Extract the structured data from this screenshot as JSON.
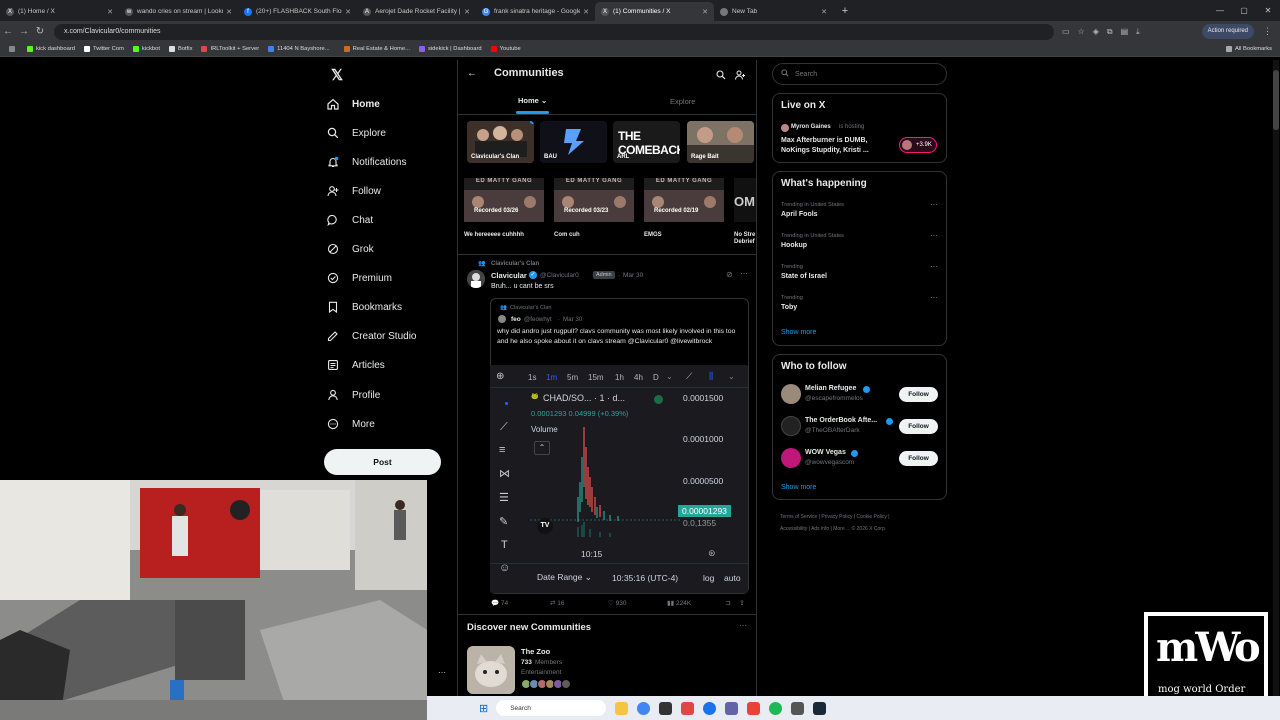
{
  "tabs": [
    {
      "title": "(1) Home / X",
      "fav": "X"
    },
    {
      "title": "wando cries on stream | Lookup",
      "fav": "w"
    },
    {
      "title": "(20+) FLASHBACK South Florida",
      "fav": "f"
    },
    {
      "title": "Aerojet Dade Rocket Facility | A",
      "fav": "A"
    },
    {
      "title": "frank sinatra heritage - Google",
      "fav": "G"
    },
    {
      "title": "(1) Communities / X",
      "fav": "X"
    },
    {
      "title": "New Tab",
      "fav": ""
    }
  ],
  "address": {
    "url": "x.com/Clavicular0/communities",
    "action_required": "Action required"
  },
  "bookmarks": [
    "kick dashboard",
    "Twitter Com",
    "kickbot",
    "Botfix",
    "IRLToolkit + Server",
    "11404 N Bayshore...",
    "Real Estate & Home...",
    "sidekick | Dashboard",
    "Youtube"
  ],
  "all_bookmarks": "All Bookmarks",
  "nav": {
    "items": [
      {
        "label": "Home",
        "icon": "home-icon"
      },
      {
        "label": "Explore",
        "icon": "search-icon"
      },
      {
        "label": "Notifications",
        "icon": "bell-icon"
      },
      {
        "label": "Follow",
        "icon": "person-plus-icon"
      },
      {
        "label": "Chat",
        "icon": "chat-icon"
      },
      {
        "label": "Grok",
        "icon": "grok-icon"
      },
      {
        "label": "Premium",
        "icon": "premium-icon"
      },
      {
        "label": "Bookmarks",
        "icon": "bookmark-icon"
      },
      {
        "label": "Creator Studio",
        "icon": "creator-icon"
      },
      {
        "label": "Articles",
        "icon": "article-icon"
      },
      {
        "label": "Profile",
        "icon": "person-icon"
      },
      {
        "label": "More",
        "icon": "more-circle-icon"
      }
    ],
    "post": "Post"
  },
  "communities": {
    "title": "Communities",
    "tab_home": "Home",
    "tab_explore": "Explore",
    "tiles": [
      "Clavicular's Clan",
      "BAU",
      "ARL",
      "Rage Bait"
    ],
    "comeback_text": "THE COMEBACK",
    "recordings": [
      {
        "band": "ED MATTY GANG",
        "badge": "Recorded 03/26",
        "title": "We hereeeee cuhhhh"
      },
      {
        "band": "ED MATTY GANG",
        "badge": "Recorded 03/23",
        "title": "Com cuh"
      },
      {
        "band": "ED MATTY GANG",
        "badge": "Recorded 02/19",
        "title": "EMGS"
      },
      {
        "band": "OM",
        "badge": "",
        "title": "No Stre Debrief"
      }
    ],
    "post": {
      "community": "Clavicular's Clan",
      "author": "Clavicular",
      "handle": "@Clavicular0",
      "role": "Admin",
      "date": "Mar 30",
      "text": "Bruh... u cant be srs",
      "quote": {
        "community": "Clavicular's Clan",
        "author": "feo",
        "handle": "@feowhyt",
        "date": "Mar 30",
        "text": "why did andro just rugpull? clavs community was most likely involved in this too and he also spoke about it on clavs stream @Clavicular0 @livewitbrock"
      },
      "chart": {
        "intervals": [
          "1s",
          "1m",
          "5m",
          "15m",
          "1h",
          "4h",
          "D"
        ],
        "active_interval": "1m",
        "symbol": "CHAD/SO...",
        "symbol_suffix": "· 1 · d...",
        "ohlc": "0.0001293 0.04999 (+0.39%)",
        "volume": "Volume",
        "prices": [
          "0.0001500",
          "0.0001000",
          "0.0000500"
        ],
        "current_price": "0.00001293",
        "last_price": "0.0,1355",
        "time_label": "10:15",
        "date_range": "Date Range",
        "clock": "10:35:16 (UTC-4)",
        "log": "log",
        "auto": "auto"
      },
      "stats": {
        "replies": "74",
        "reposts": "16",
        "likes": "930",
        "views": "224K"
      }
    },
    "discover": {
      "title": "Discover new Communities",
      "name": "The Zoo",
      "members": "733",
      "members_label": "Members",
      "category": "Entertainment"
    }
  },
  "right": {
    "search_placeholder": "Search",
    "live": {
      "title": "Live on X",
      "host": "Myron Gaines",
      "hosting": "is hosting",
      "text": "Max Afterburner is DUMB, NoKings Stupdity,  Kristi ...",
      "count": "+3.9K"
    },
    "happening": {
      "title": "What's happening",
      "items": [
        {
          "context": "Trending in United States",
          "topic": "April Fools"
        },
        {
          "context": "Trending in United States",
          "topic": "Hookup"
        },
        {
          "context": "Trending",
          "topic": "State of Israel"
        },
        {
          "context": "Trending",
          "topic": "Toby"
        }
      ],
      "show_more": "Show more"
    },
    "who": {
      "title": "Who to follow",
      "items": [
        {
          "name": "Melian Refugee",
          "handle": "@escapefrommelos"
        },
        {
          "name": "The OrderBook Afte...",
          "handle": "@TheOBAfterDark"
        },
        {
          "name": "WOW Vegas",
          "handle": "@wowvegascom"
        }
      ],
      "follow": "Follow",
      "show_more": "Show more"
    },
    "footer": [
      "Terms of Service",
      "|",
      "Privacy Policy",
      "|",
      "Cookie Policy",
      "|",
      "Accessibility",
      "|",
      "Ads info",
      "|",
      "More ...",
      "© 2026 X Corp."
    ]
  },
  "overlay": {
    "logo_top": "mWo",
    "logo_bottom": "mog world Order"
  },
  "taskbar": {
    "search": "Search"
  }
}
